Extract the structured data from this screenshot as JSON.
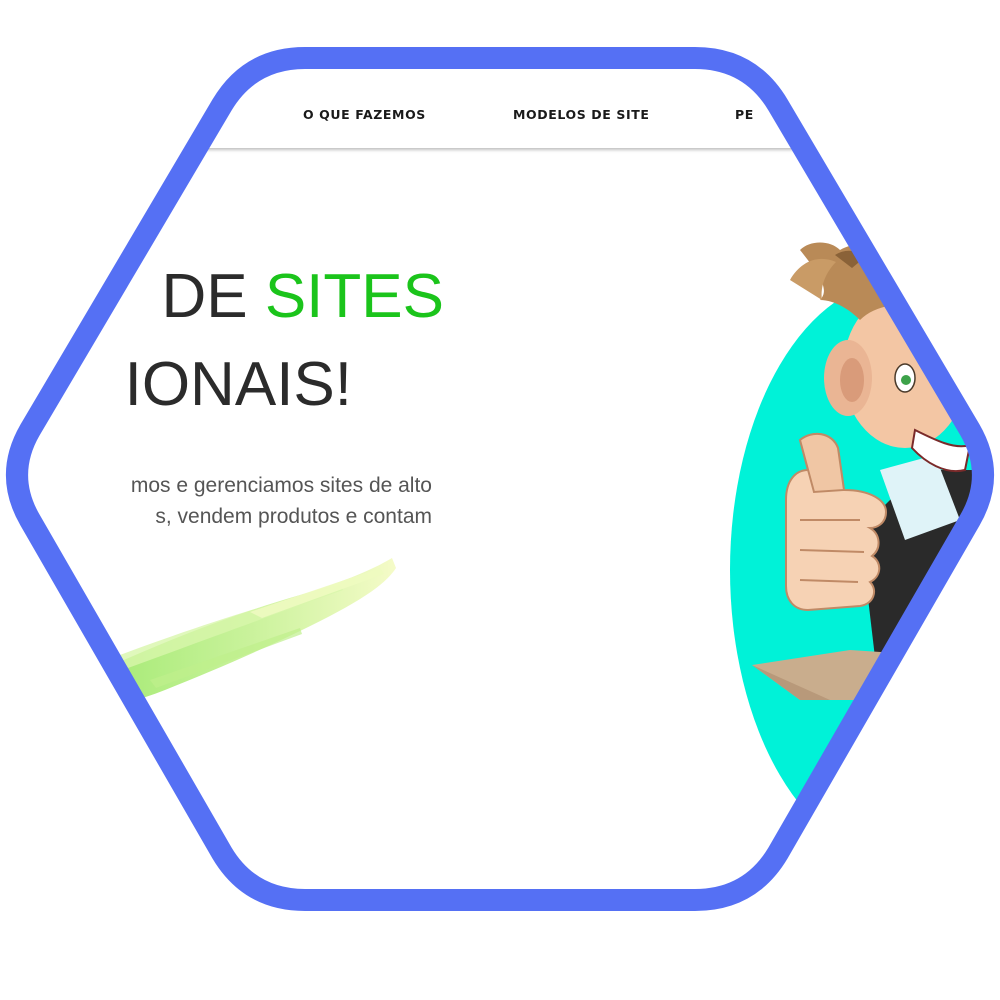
{
  "nav": {
    "items": [
      {
        "label": "O QUE FAZEMOS"
      },
      {
        "label": "MODELOS DE SITE"
      },
      {
        "label": "PE"
      }
    ]
  },
  "hero": {
    "line1_prefix": "DE ",
    "line1_accent": "SITES",
    "line2": "IONAIS!",
    "description_lines": [
      "mos e gerenciamos sites de alto",
      "s, vendem produtos e contam"
    ]
  },
  "colors": {
    "frame": "#5570f4",
    "accent_green": "#1bc41b",
    "mascot_background": "#00f2d8",
    "text_dark": "#2b2b2b",
    "text_body": "#555555"
  },
  "icons": {
    "brush_stroke": "decorative-brush-stroke",
    "mascot": "thumbs-up-cartoon-mascot"
  }
}
